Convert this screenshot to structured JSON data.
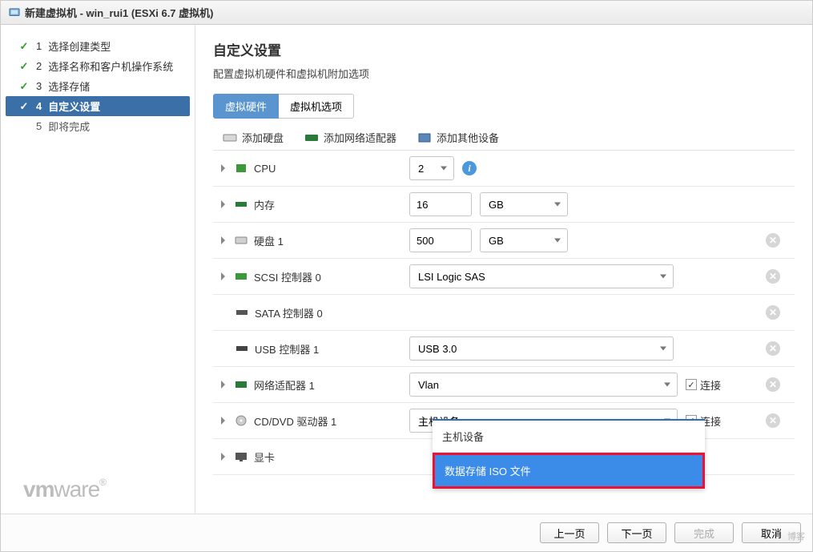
{
  "window": {
    "title": "新建虚拟机 - win_rui1 (ESXi 6.7 虚拟机)"
  },
  "steps": [
    {
      "num": "1",
      "label": "选择创建类型",
      "state": "done"
    },
    {
      "num": "2",
      "label": "选择名称和客户机操作系统",
      "state": "done"
    },
    {
      "num": "3",
      "label": "选择存储",
      "state": "done"
    },
    {
      "num": "4",
      "label": "自定义设置",
      "state": "active"
    },
    {
      "num": "5",
      "label": "即将完成",
      "state": "pending"
    }
  ],
  "logo": {
    "brand": "vm",
    "rest": "ware",
    "reg": "®"
  },
  "main": {
    "heading": "自定义设置",
    "subtitle": "配置虚拟机硬件和虚拟机附加选项",
    "tabs": [
      {
        "label": "虚拟硬件",
        "active": true
      },
      {
        "label": "虚拟机选项",
        "active": false
      }
    ],
    "toolbar": {
      "add_disk": "添加硬盘",
      "add_nic": "添加网络适配器",
      "add_other": "添加其他设备"
    }
  },
  "hw": {
    "cpu": {
      "label": "CPU",
      "value": "2"
    },
    "mem": {
      "label": "内存",
      "value": "16",
      "unit": "GB"
    },
    "disk": {
      "label": "硬盘 1",
      "value": "500",
      "unit": "GB"
    },
    "scsi": {
      "label": "SCSI 控制器 0",
      "value": "LSI Logic SAS"
    },
    "sata": {
      "label": "SATA 控制器 0"
    },
    "usb": {
      "label": "USB 控制器 1",
      "value": "USB 3.0"
    },
    "nic": {
      "label": "网络适配器 1",
      "value": "Vlan",
      "connect": "连接",
      "checked": true
    },
    "cd": {
      "label": "CD/DVD 驱动器 1",
      "value": "主机设备",
      "connect": "连接",
      "checked": true
    },
    "video": {
      "label": "显卡"
    }
  },
  "dropdown": {
    "opt1": "主机设备",
    "opt2": "数据存储 ISO 文件"
  },
  "footer": {
    "prev": "上一页",
    "next": "下一页",
    "finish": "完成",
    "cancel": "取消"
  },
  "watermark": "博客"
}
